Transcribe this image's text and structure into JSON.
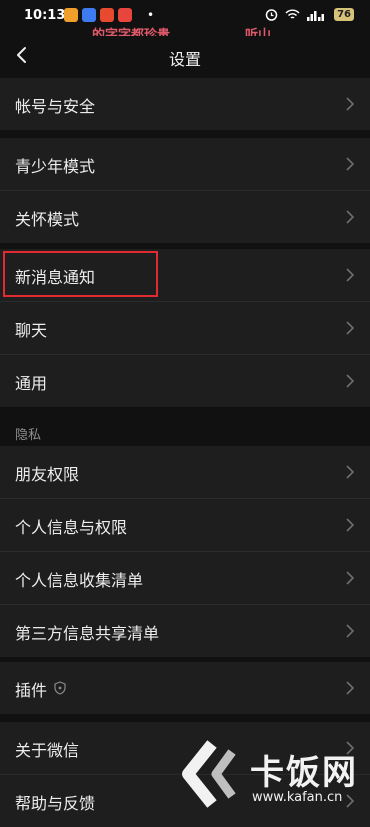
{
  "status_bar": {
    "time": "10:13",
    "battery": "76",
    "overlay_left": "的字字都珍贵",
    "overlay_right": "听山"
  },
  "nav": {
    "title": "设置"
  },
  "groups": {
    "account": [
      {
        "label": "帐号与安全"
      }
    ],
    "modes": [
      {
        "label": "青少年模式"
      },
      {
        "label": "关怀模式"
      }
    ],
    "messages": [
      {
        "label": "新消息通知"
      },
      {
        "label": "聊天"
      },
      {
        "label": "通用"
      }
    ],
    "privacy_header": "隐私",
    "privacy": [
      {
        "label": "朋友权限"
      },
      {
        "label": "个人信息与权限"
      },
      {
        "label": "个人信息收集清单"
      },
      {
        "label": "第三方信息共享清单"
      }
    ],
    "plugins": [
      {
        "label": "插件"
      }
    ],
    "about": [
      {
        "label": "关于微信"
      },
      {
        "label": "帮助与反馈"
      }
    ]
  },
  "highlight": {
    "target": "新消息通知",
    "color": "#e02b33"
  },
  "watermark": {
    "brand": "卡饭网",
    "url": "www.kafan.cn"
  },
  "colors": {
    "background": "#111111",
    "row": "#1e1e1e",
    "text": "#ededed",
    "muted": "#8d8d8d"
  }
}
